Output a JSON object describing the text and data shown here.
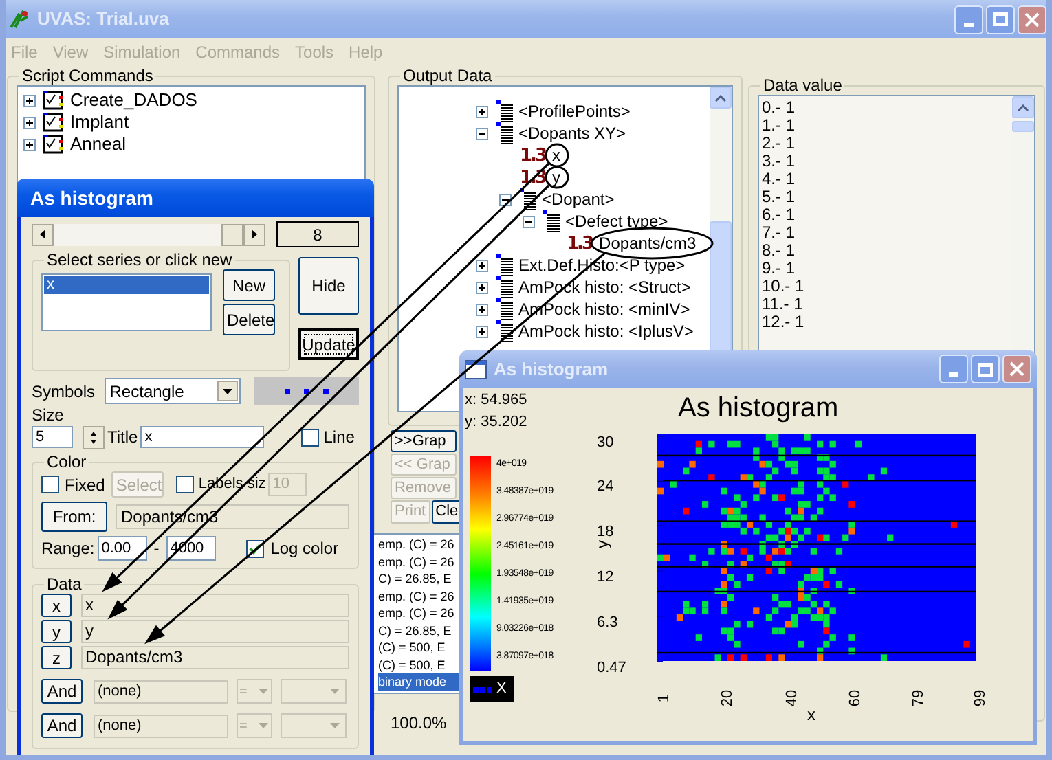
{
  "window": {
    "title": "UVAS: Trial.uva"
  },
  "menu": [
    {
      "label": "File",
      "disabled": true
    },
    {
      "label": "View",
      "disabled": true
    },
    {
      "label": "Simulation",
      "disabled": true
    },
    {
      "label": "Commands",
      "disabled": true
    },
    {
      "label": "Tools",
      "disabled": true
    },
    {
      "label": "Help",
      "disabled": true
    }
  ],
  "script_commands": {
    "title": "Script Commands",
    "items": [
      {
        "label": "Create_DADOS",
        "expanded": false
      },
      {
        "label": "Implant",
        "expanded": false
      },
      {
        "label": "Anneal",
        "expanded": false
      }
    ]
  },
  "output_data": {
    "title": "Output Data",
    "tree": [
      {
        "kind": "folder",
        "label": "<ProfilePoints>",
        "expanded": false
      },
      {
        "kind": "folder",
        "label": "<Dopants XY>",
        "expanded": true,
        "children": [
          {
            "kind": "value",
            "badge": "1.3",
            "label": "x"
          },
          {
            "kind": "value",
            "badge": "1.3",
            "label": "y"
          },
          {
            "kind": "folder",
            "label": "<Dopant>",
            "expanded": true,
            "children": [
              {
                "kind": "folder",
                "label": "<Defect type>",
                "expanded": true,
                "children": [
                  {
                    "kind": "value",
                    "badge": "1.3",
                    "label": "Dopants/cm3"
                  }
                ]
              }
            ]
          }
        ]
      },
      {
        "kind": "folder",
        "label": "Ext.Def.Histo:<P type>",
        "expanded": false
      },
      {
        "kind": "folder",
        "label": "AmPock histo: <Struct>",
        "expanded": false
      },
      {
        "kind": "folder",
        "label": "AmPock histo: <minIV>",
        "expanded": false
      },
      {
        "kind": "folder",
        "label": "AmPock histo: <IplusV>",
        "expanded": false
      }
    ],
    "buttons": [
      {
        "label": ">>Grap",
        "disabled": false
      },
      {
        "label": "<< Grap",
        "disabled": true
      },
      {
        "label": "Remove",
        "disabled": true
      }
    ],
    "small_buttons": [
      {
        "label": "Print",
        "disabled": true
      },
      {
        "label": "Cle",
        "disabled": false
      }
    ],
    "log": [
      {
        "text": "emp. (C) = 26",
        "selected": false
      },
      {
        "text": "emp. (C) = 26",
        "selected": false
      },
      {
        "text": "C) = 26.85, E",
        "selected": false
      },
      {
        "text": "emp. (C) = 26",
        "selected": false
      },
      {
        "text": "emp. (C) = 26",
        "selected": false
      },
      {
        "text": "C) = 26.85, E",
        "selected": false
      },
      {
        "text": "(C) = 500, E",
        "selected": false
      },
      {
        "text": "(C) = 500, E",
        "selected": false
      },
      {
        "text": "binary mode",
        "selected": true
      }
    ],
    "zoom": "100.0%"
  },
  "data_value": {
    "title": "Data value",
    "items": [
      "0.- 1",
      "1.- 1",
      "2.- 1",
      "3.- 1",
      "4.- 1",
      "5.- 1",
      "6.- 1",
      "7.- 1",
      "8.- 1",
      "9.- 1",
      "10.- 1",
      "11.- 1",
      "12.- 1"
    ]
  },
  "histogram_dialog": {
    "title": "As histogram",
    "scroll_value": "8",
    "series_group": {
      "title": "Select series or click new",
      "series": [
        {
          "label": "x",
          "selected": true
        }
      ],
      "buttons": [
        "New",
        "Delete"
      ]
    },
    "hide_button": "Hide",
    "update_button": "Update",
    "symbols": {
      "label": "Symbols",
      "value": "Rectangle"
    },
    "size": {
      "label": "Size",
      "value": "5"
    },
    "title_field": {
      "label": "Title",
      "value": "x"
    },
    "line": {
      "label": "Line",
      "checked": false
    },
    "color": {
      "title": "Color",
      "fixed": {
        "label": "Fixed",
        "checked": false
      },
      "select_button": {
        "label": "Select",
        "disabled": true
      },
      "labels_size": {
        "label": "Labels siz",
        "checked": false,
        "value": "10",
        "value_disabled": true
      },
      "from_button": "From:",
      "from_value": "Dopants/cm3",
      "range_label": "Range:",
      "range_min": "0.00",
      "range_sep": "-",
      "range_max": "4000",
      "log_color": {
        "label": "Log color",
        "checked": true
      }
    },
    "data": {
      "title": "Data",
      "axes": [
        {
          "button": "x",
          "value": "x"
        },
        {
          "button": "y",
          "value": "y"
        },
        {
          "button": "z",
          "value": "Dopants/cm3"
        }
      ],
      "filters": [
        {
          "button": "And",
          "value": "(none)",
          "operator": "="
        },
        {
          "button": "And",
          "value": "(none)",
          "operator": "="
        }
      ]
    }
  },
  "plot_window": {
    "title": "As histogram",
    "cursor_x": "x: 54.965",
    "cursor_y": "y: 35.202",
    "chart_title": "As histogram",
    "colorbar_labels": [
      "4e+019",
      "3.48387e+019",
      "2.96774e+019",
      "2.45161e+019",
      "1.93548e+019",
      "1.41935e+019",
      "9.03226e+018",
      "3.87097e+018"
    ],
    "legend_label": "X",
    "yticks": [
      "30",
      "24",
      "18",
      "12",
      "6.3",
      "0.47"
    ],
    "xticks": [
      "1",
      "20",
      "40",
      "60",
      "79",
      "99"
    ],
    "xlabel": "x",
    "ylabel": "y"
  }
}
